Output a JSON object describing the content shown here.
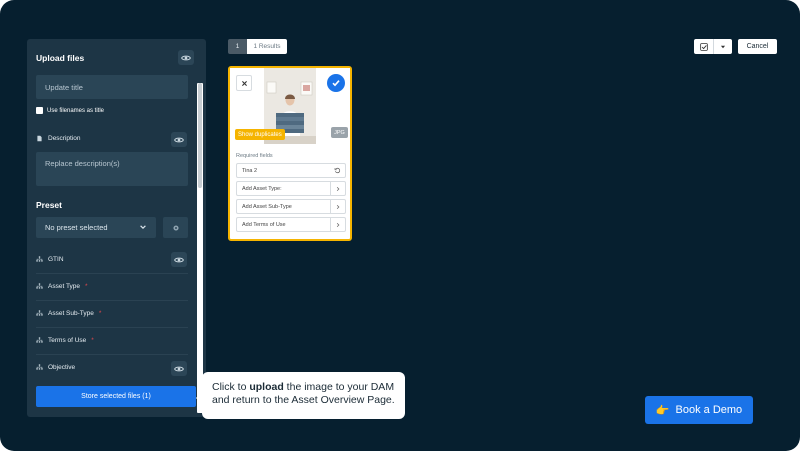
{
  "upload_panel": {
    "title": "Upload files",
    "title_placeholder": "Update title",
    "use_filenames_label": "Use filenames as title",
    "description_label": "Description",
    "description_placeholder": "Replace description(s)",
    "preset_title": "Preset",
    "preset_value": "No preset selected",
    "fields": [
      {
        "label": "GTIN",
        "required": false
      },
      {
        "label": "Asset Type",
        "required": true
      },
      {
        "label": "Asset Sub-Type",
        "required": true
      },
      {
        "label": "Terms of Use",
        "required": true
      },
      {
        "label": "Objective",
        "required": false
      }
    ],
    "required_mark": "*",
    "store_button": "Store selected files  (1)"
  },
  "tooltip": {
    "before": "Click to ",
    "bold": "upload",
    "after": " the image to your DAM and return to the Asset Overview Page."
  },
  "toolbar": {
    "count": "1",
    "results": "1 Results",
    "cancel": "Cancel"
  },
  "asset_card": {
    "duplicates_badge": "Show duplicates",
    "file_type": "JPG",
    "required_fields_label": "Required fields",
    "title_value": "Tina 2",
    "add_asset_type": "Add Asset Type:",
    "add_asset_subtype": "Add Asset Sub-Type",
    "add_terms": "Add Terms of Use"
  },
  "demo": {
    "label": "Book a Demo",
    "emoji": "👉"
  },
  "colors": {
    "background": "#061f2f",
    "panel": "#1d3545",
    "accent": "#1a73e8",
    "highlight": "#f5b400"
  }
}
